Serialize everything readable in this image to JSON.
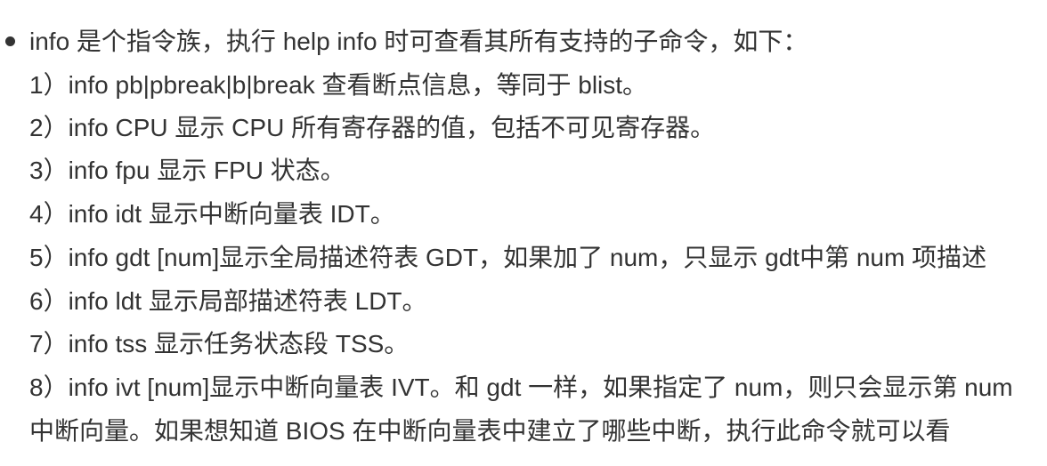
{
  "bullet_intro": "info 是个指令族，执行 help info 时可查看其所有支持的子命令，如下：",
  "items": [
    "1）info pb|pbreak|b|break 查看断点信息，等同于 blist。",
    "2）info CPU 显示 CPU 所有寄存器的值，包括不可见寄存器。",
    "3）info fpu 显示 FPU 状态。",
    "4）info idt 显示中断向量表 IDT。",
    "5）info gdt [num]显示全局描述符表 GDT，如果加了 num，只显示 gdt中第 num 项描述",
    "6）info ldt 显示局部描述符表 LDT。",
    "7）info tss 显示任务状态段 TSS。",
    "8）info ivt [num]显示中断向量表 IVT。和 gdt 一样，如果指定了 num，则只会显示第 num",
    "中断向量。如果想知道 BIOS 在中断向量表中建立了哪些中断，执行此命令就可以看"
  ]
}
